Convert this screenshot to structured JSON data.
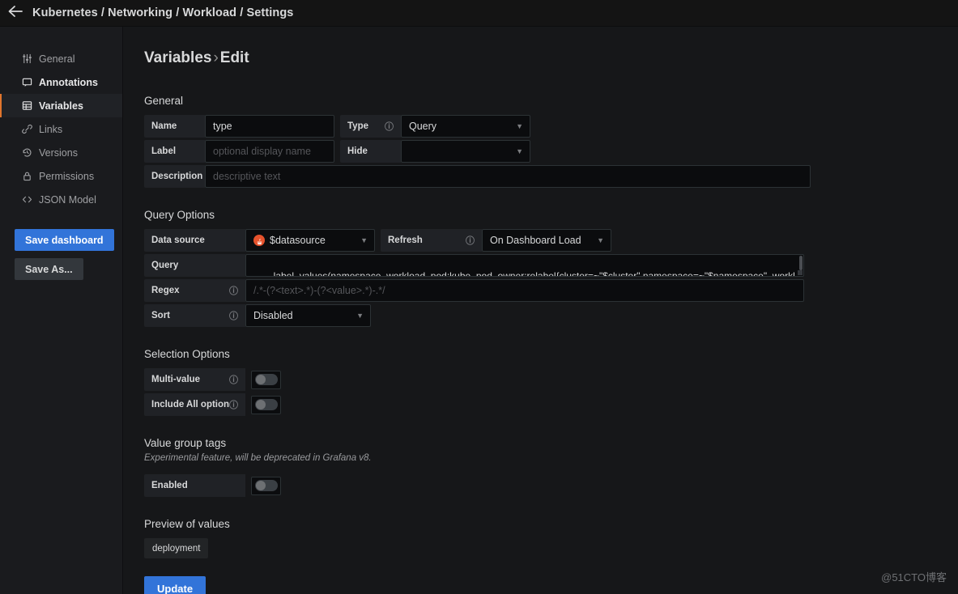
{
  "topbar": {
    "back_icon": "arrow-left-icon",
    "breadcrumb": "Kubernetes / Networking / Workload / Settings"
  },
  "sidebar": {
    "items": [
      {
        "label": "General",
        "icon": "sliders-icon"
      },
      {
        "label": "Annotations",
        "icon": "comment-icon"
      },
      {
        "label": "Variables",
        "icon": "table-icon"
      },
      {
        "label": "Links",
        "icon": "link-icon"
      },
      {
        "label": "Versions",
        "icon": "history-icon"
      },
      {
        "label": "Permissions",
        "icon": "lock-icon"
      },
      {
        "label": "JSON Model",
        "icon": "code-icon"
      }
    ],
    "save_dashboard_label": "Save dashboard",
    "save_as_label": "Save As..."
  },
  "main": {
    "title": "Variables",
    "title_sep": "›",
    "title_sub": "Edit",
    "general": {
      "heading": "General",
      "name_label": "Name",
      "name_value": "type",
      "type_label": "Type",
      "type_value": "Query",
      "label_label": "Label",
      "label_placeholder": "optional display name",
      "hide_label": "Hide",
      "hide_value": "",
      "description_label": "Description",
      "description_placeholder": "descriptive text"
    },
    "query_options": {
      "heading": "Query Options",
      "datasource_label": "Data source",
      "datasource_value": "$datasource",
      "refresh_label": "Refresh",
      "refresh_value": "On Dashboard Load",
      "query_label": "Query",
      "query_value": "label_values(namespace_workload_pod:kube_pod_owner:relabel{cluster=~\"$cluster\",namespace=~\"$namespace\", workload=~\"$workload\"}, workload_type)",
      "regex_label": "Regex",
      "regex_placeholder": "/.*-(?<text>.*)-(?<value>.*)-.*/",
      "sort_label": "Sort",
      "sort_value": "Disabled"
    },
    "selection_options": {
      "heading": "Selection Options",
      "multivalue_label": "Multi-value",
      "multivalue_on": false,
      "includeall_label": "Include All option",
      "includeall_on": false
    },
    "value_group_tags": {
      "heading": "Value group tags",
      "note": "Experimental feature, will be deprecated in Grafana v8.",
      "enabled_label": "Enabled",
      "enabled_on": false
    },
    "preview": {
      "heading": "Preview of values",
      "values": [
        "deployment"
      ]
    },
    "update_label": "Update"
  },
  "watermark": "@51CTO博客",
  "colors": {
    "accent_blue": "#3274d9",
    "active_orange": "#e0752d",
    "prometheus_red": "#e6522c"
  }
}
